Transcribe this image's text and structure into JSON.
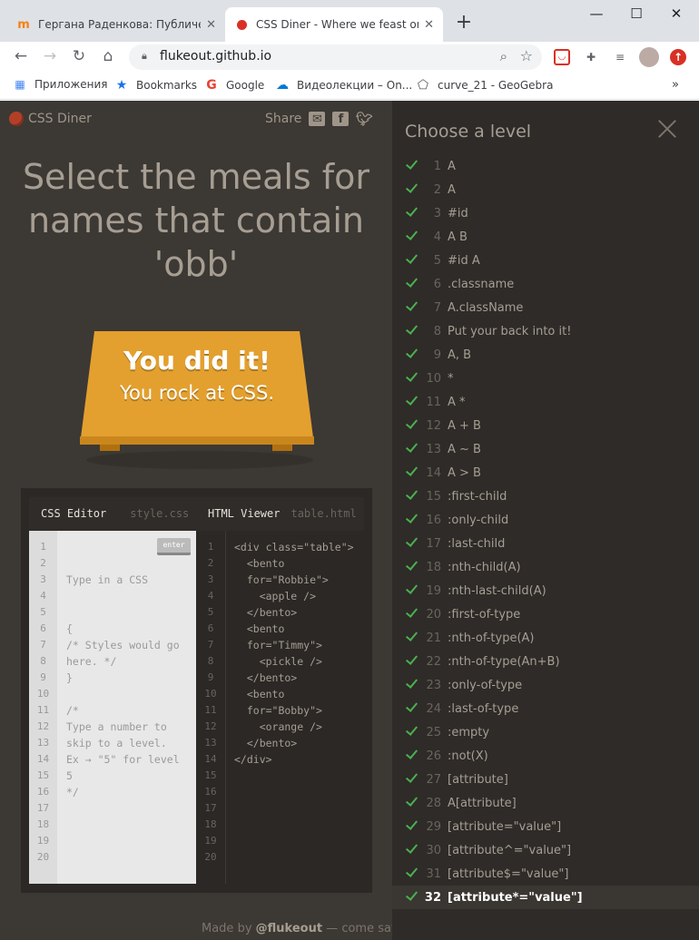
{
  "browser": {
    "tabs": [
      {
        "title": "Гергана Раденкова: Публичен п"
      },
      {
        "title": "CSS Diner - Where we feast on C"
      }
    ],
    "url": "flukeout.github.io",
    "bookmarks": [
      "Приложения",
      "Bookmarks",
      "Google",
      "Видеолекции – On...",
      "curve_21 - GeoGebra"
    ]
  },
  "game": {
    "logo": "CSS Diner",
    "share": "Share",
    "instruction": "Select the meals for names that contain 'obb'",
    "win_title": "You did it!",
    "win_sub": "You rock at CSS.",
    "editor": {
      "css_title": "CSS Editor",
      "css_file": "style.css",
      "html_title": "HTML Viewer",
      "html_file": "table.html",
      "enter": "enter",
      "placeholder": "Type in a CSS",
      "css_code": "{\n/* Styles would go\nhere. */\n}\n\n/*\nType a number to\nskip to a level.\nEx → \"5\" for level\n5\n*/",
      "html_code": "<div class=\"table\">\n  <bento\n  for=\"Robbie\">\n    <apple />\n  </bento>\n  <bento\n  for=\"Timmy\">\n    <pickle />\n  </bento>\n  <bento\n  for=\"Bobby\">\n    <orange />\n  </bento>\n</div>"
    },
    "credit_prefix": "Made by ",
    "credit_author": "@flukeout",
    "credit_suffix": " — come say hi!"
  },
  "levels": {
    "title": "Choose a level",
    "current": 32,
    "items": [
      {
        "n": "1",
        "name": "A"
      },
      {
        "n": "2",
        "name": "A"
      },
      {
        "n": "3",
        "name": "#id"
      },
      {
        "n": "4",
        "name": "A  B"
      },
      {
        "n": "5",
        "name": "#id  A"
      },
      {
        "n": "6",
        "name": ".classname"
      },
      {
        "n": "7",
        "name": "A.className"
      },
      {
        "n": "8",
        "name": "Put your back into it!"
      },
      {
        "n": "9",
        "name": "A, B"
      },
      {
        "n": "10",
        "name": "*"
      },
      {
        "n": "11",
        "name": "A  *"
      },
      {
        "n": "12",
        "name": "A + B"
      },
      {
        "n": "13",
        "name": "A ~ B"
      },
      {
        "n": "14",
        "name": "A > B"
      },
      {
        "n": "15",
        "name": ":first-child"
      },
      {
        "n": "16",
        "name": ":only-child"
      },
      {
        "n": "17",
        "name": ":last-child"
      },
      {
        "n": "18",
        "name": ":nth-child(A)"
      },
      {
        "n": "19",
        "name": ":nth-last-child(A)"
      },
      {
        "n": "20",
        "name": ":first-of-type"
      },
      {
        "n": "21",
        "name": ":nth-of-type(A)"
      },
      {
        "n": "22",
        "name": ":nth-of-type(An+B)"
      },
      {
        "n": "23",
        "name": ":only-of-type"
      },
      {
        "n": "24",
        "name": ":last-of-type"
      },
      {
        "n": "25",
        "name": ":empty"
      },
      {
        "n": "26",
        "name": ":not(X)"
      },
      {
        "n": "27",
        "name": "[attribute]"
      },
      {
        "n": "28",
        "name": "A[attribute]"
      },
      {
        "n": "29",
        "name": "[attribute=\"value\"]"
      },
      {
        "n": "30",
        "name": "[attribute^=\"value\"]"
      },
      {
        "n": "31",
        "name": "[attribute$=\"value\"]"
      },
      {
        "n": "32",
        "name": "[attribute*=\"value\"]"
      }
    ]
  }
}
